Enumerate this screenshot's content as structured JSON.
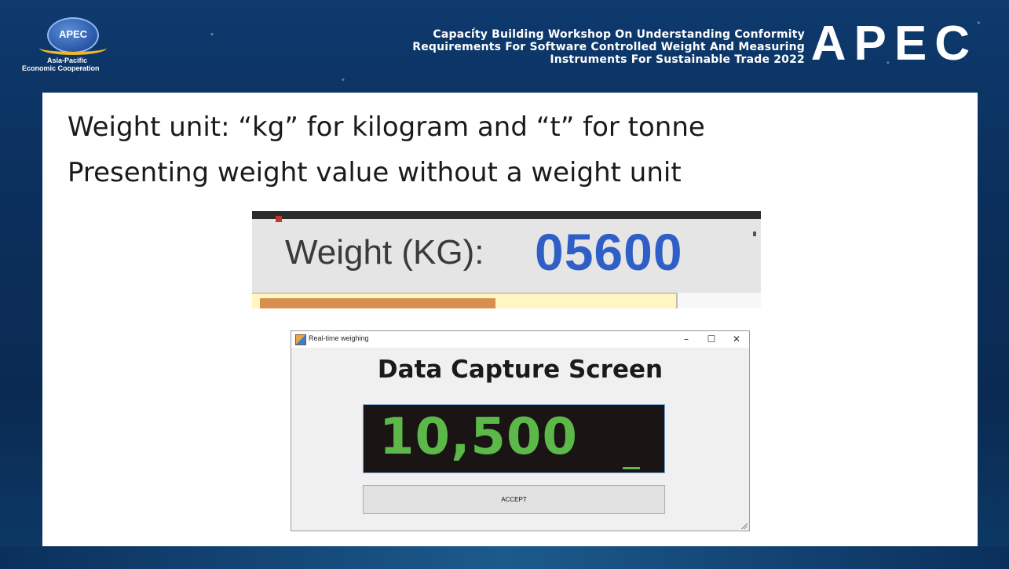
{
  "header": {
    "logo_mark": "APEC",
    "logo_caption_1": "Asia-Pacific",
    "logo_caption_2": "Economic Cooperation",
    "workshop_title_line1": "Capacity Building Workshop On Understanding Conformity",
    "workshop_title_line2": "Requirements For Software Controlled Weight And Measuring",
    "workshop_title_line3": "Instruments For Sustainable Trade 2022",
    "brand_word": "APEC"
  },
  "slide": {
    "line1": "Weight unit: “kg” for kilogram and “t” for tonne",
    "line2": "Presenting weight value without a weight unit"
  },
  "weight_crop": {
    "label": "Weight (KG):",
    "value": "05600"
  },
  "window": {
    "title": "Real-time weighing",
    "minimize_glyph": "–",
    "maximize_glyph": "☐",
    "close_glyph": "✕",
    "heading": "Data Capture Screen",
    "reading": "10,500",
    "accept_label": "ACCEPT"
  },
  "colors": {
    "reading_green": "#5db84a",
    "weight_value_blue": "#2f5fc6",
    "apec_gold": "#f0b62a",
    "slide_background": "#0b2f5c"
  }
}
